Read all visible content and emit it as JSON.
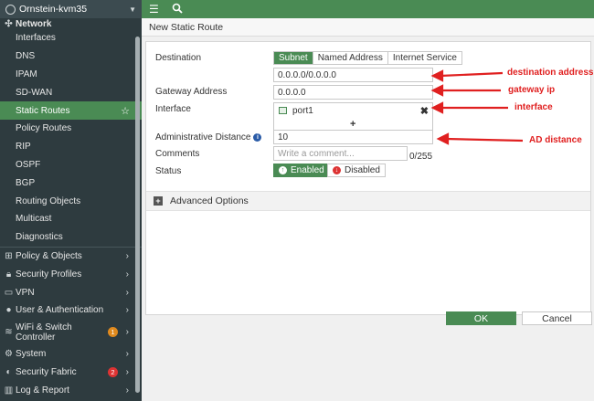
{
  "sidebar": {
    "device_name": "Ornstein-kvm35",
    "section_title": "Network",
    "items": [
      {
        "label": "Interfaces"
      },
      {
        "label": "DNS"
      },
      {
        "label": "IPAM"
      },
      {
        "label": "SD-WAN"
      },
      {
        "label": "Static Routes"
      },
      {
        "label": "Policy Routes"
      },
      {
        "label": "RIP"
      },
      {
        "label": "OSPF"
      },
      {
        "label": "BGP"
      },
      {
        "label": "Routing Objects"
      },
      {
        "label": "Multicast"
      },
      {
        "label": "Diagnostics"
      }
    ],
    "groups": [
      {
        "label": "Policy & Objects",
        "icon": "policy-icon"
      },
      {
        "label": "Security Profiles",
        "icon": "lock-icon"
      },
      {
        "label": "VPN",
        "icon": "monitor-icon"
      },
      {
        "label": "User & Authentication",
        "icon": "user-icon"
      },
      {
        "label": "WiFi & Switch Controller",
        "icon": "wifi-icon",
        "badge": "1"
      },
      {
        "label": "System",
        "icon": "gear-icon"
      },
      {
        "label": "Security Fabric",
        "icon": "fabric-icon",
        "badge": "2"
      },
      {
        "label": "Log & Report",
        "icon": "chart-icon"
      }
    ]
  },
  "page": {
    "title": "New Static Route"
  },
  "form": {
    "destination_label": "Destination",
    "dest_types": [
      "Subnet",
      "Named Address",
      "Internet Service"
    ],
    "destination_value": "0.0.0.0/0.0.0.0",
    "gateway_label": "Gateway Address",
    "gateway_value": "0.0.0.0",
    "interface_label": "Interface",
    "interface_value": "port1",
    "ad_label": "Administrative Distance",
    "ad_value": "10",
    "comments_label": "Comments",
    "comments_placeholder": "Write a comment...",
    "comments_counter": "0/255",
    "status_label": "Status",
    "status_enabled": "Enabled",
    "status_disabled": "Disabled",
    "advanced_options": "Advanced Options"
  },
  "annotations": {
    "destination": "destination address",
    "gateway": "gateway ip",
    "interface": "interface",
    "ad": "AD distance"
  },
  "buttons": {
    "ok": "OK",
    "cancel": "Cancel"
  },
  "colors": {
    "accent": "#4a8b54",
    "sidebar_bg": "#2e3b3f",
    "annotation": "#e02020"
  }
}
